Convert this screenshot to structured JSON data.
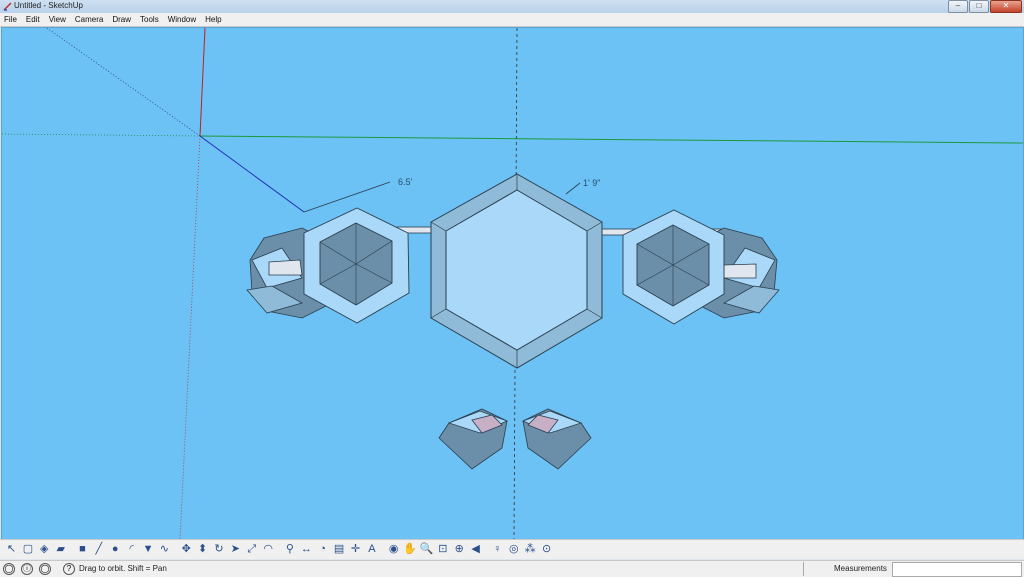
{
  "window": {
    "title": "Untitled - SketchUp"
  },
  "menu": {
    "items": [
      "File",
      "Edit",
      "View",
      "Camera",
      "Draw",
      "Tools",
      "Window",
      "Help"
    ]
  },
  "dimensions": {
    "left": "6.5'",
    "right": "1' 9\""
  },
  "status": {
    "hint": "Drag to orbit.  Shift = Pan",
    "measurements_label": "Measurements",
    "measurements_value": ""
  },
  "toolbar": {
    "tools": [
      {
        "name": "select-tool-icon",
        "glyph": "↖"
      },
      {
        "name": "make-component-icon",
        "glyph": "▢"
      },
      {
        "name": "paint-bucket-icon",
        "glyph": "◈"
      },
      {
        "name": "eraser-icon",
        "glyph": "▰"
      },
      {
        "name": "rectangle-tool-icon",
        "glyph": "■"
      },
      {
        "name": "line-tool-icon",
        "glyph": "╱"
      },
      {
        "name": "circle-tool-icon",
        "glyph": "●"
      },
      {
        "name": "arc-tool-icon",
        "glyph": "◜"
      },
      {
        "name": "polygon-tool-icon",
        "glyph": "▼"
      },
      {
        "name": "freehand-tool-icon",
        "glyph": "∿"
      },
      {
        "name": "move-tool-icon",
        "glyph": "✥"
      },
      {
        "name": "push-pull-icon",
        "glyph": "⬍"
      },
      {
        "name": "rotate-tool-icon",
        "glyph": "↻"
      },
      {
        "name": "follow-me-icon",
        "glyph": "➤"
      },
      {
        "name": "scale-tool-icon",
        "glyph": "⤢"
      },
      {
        "name": "offset-tool-icon",
        "glyph": "◠"
      },
      {
        "name": "tape-measure-icon",
        "glyph": "⚲"
      },
      {
        "name": "dimension-tool-icon",
        "glyph": "↔"
      },
      {
        "name": "protractor-icon",
        "glyph": "◔"
      },
      {
        "name": "text-tool-icon",
        "glyph": "▤"
      },
      {
        "name": "axes-tool-icon",
        "glyph": "✛"
      },
      {
        "name": "3d-text-icon",
        "glyph": "A"
      },
      {
        "name": "orbit-tool-icon",
        "glyph": "◉"
      },
      {
        "name": "pan-tool-icon",
        "glyph": "✋"
      },
      {
        "name": "zoom-tool-icon",
        "glyph": "🔍"
      },
      {
        "name": "zoom-window-icon",
        "glyph": "⊡"
      },
      {
        "name": "zoom-extents-icon",
        "glyph": "⊕"
      },
      {
        "name": "previous-view-icon",
        "glyph": "◀"
      },
      {
        "name": "position-camera-icon",
        "glyph": "♀"
      },
      {
        "name": "look-around-icon",
        "glyph": "◎"
      },
      {
        "name": "walk-tool-icon",
        "glyph": "⁂"
      },
      {
        "name": "section-plane-icon",
        "glyph": "⊙"
      }
    ]
  },
  "colors": {
    "sky": "#6cc1f5",
    "face_light": "#a9d8f8",
    "face_mid": "#8fbbd8",
    "face_dark": "#6b8fa8",
    "edge": "#2a3d4e",
    "red_axis": "#c02020",
    "green_axis": "#1a9a3a",
    "blue_axis": "#2030b0"
  }
}
